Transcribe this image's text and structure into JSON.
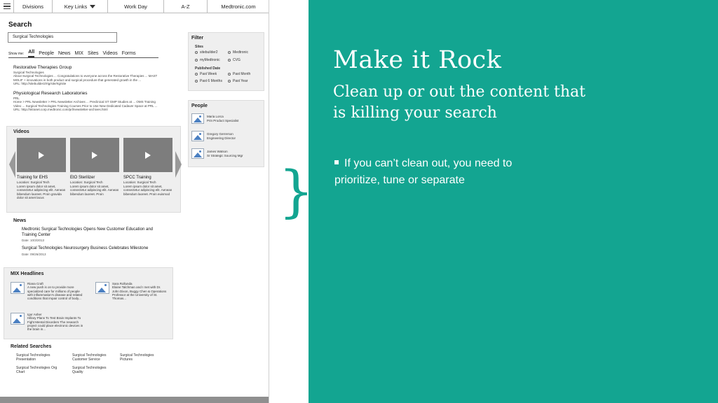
{
  "nav": {
    "divisions": "Divisions",
    "keylinks": "Key Links",
    "workday": "Work Day",
    "az": "A-Z",
    "site": "Medtronic.com"
  },
  "search": {
    "title": "Search",
    "value": "Surgical Technologies"
  },
  "tabs": {
    "label": "Show me:",
    "items": [
      "All",
      "People",
      "News",
      "MIX",
      "Sites",
      "Videos",
      "Forms"
    ]
  },
  "results": [
    {
      "title": "Restorative Therapies Group",
      "lines": [
        "Surgical Technologies",
        "About Surgical Technologies ... Congratulations to everyone across the Restorative Therapies ... MAST",
        "MOLIF + innovations in both product and surgical procedure that generated growth in the ...",
        "URL: http://sitebuilder2/rtg/site/rtg/site"
      ]
    },
    {
      "title": "Physiological Research Laboratories",
      "lines": [
        "PRL",
        "Home > PRL Newsletter > PRL Newsletter Archives ... Preclinical ST GMP Studies at ... OMS Training",
        "Video ... Surgical Technologies Training Courses Prior to Use New Dedicated Cadaver Space at PRL ...",
        "URL: http://intranet.corp.medtronic.com/prl/newsletter-archives.html"
      ]
    }
  ],
  "filter": {
    "title": "Filter",
    "sites_label": "Sites",
    "sites": [
      "sitebuilder2",
      "Medtronic",
      "myMedtronic",
      "CVG"
    ],
    "published_label": "Published Date",
    "dates": [
      "Past Week",
      "Past Month",
      "Past 6 Months",
      "Past Year"
    ]
  },
  "people": {
    "title": "People",
    "items": [
      {
        "name": "Maria Lorca",
        "role": "Prin Product Specialist"
      },
      {
        "name": "Gregory Gerrerson",
        "role": "Engineering Director"
      },
      {
        "name": "James Watson",
        "role": "Sr Strategic Sourcing Mgr"
      }
    ]
  },
  "videos": {
    "title": "Videos",
    "items": [
      {
        "title": "Training for EHS",
        "location": "Location: Surgical Tech",
        "desc": "Lorem ipsum dolor sit amet, consectetur adipiscing elit. Aenean bibendum laoreet. Proin gravida dolor sit amet lacus"
      },
      {
        "title": "EtO Sterilizer",
        "location": "Location: Surgical Tech",
        "desc": "Lorem ipsum dolor sit amet, consectetur adipiscing elit. Aenean bibendum laoreet. Proin"
      },
      {
        "title": "SPCC Training",
        "location": "Location: Surgical Tech",
        "desc": "Lorem ipsum dolor sit amet, consectetur adipiscing elit. Aenean bibendum laoreet. Proin euismod"
      }
    ]
  },
  "news": {
    "title": "News",
    "items": [
      {
        "title": "Medtronic Surgical Technologies Opens New Customer Education and Training Center",
        "date": "Date: 10/3/2013"
      },
      {
        "title": "Surgical Technologies Neurosurgery Business Celebrates Milestone",
        "date": "Date: 09/26/2013"
      }
    ]
  },
  "mix": {
    "title": "MIX Headlines",
    "items": [
      {
        "name": "Riana Craft",
        "text": "A new push is on to provide more specialized care for millions of people with inflammation's disease and related conditions that impair control of body..."
      },
      {
        "name": "Sara Rollunda",
        "text": "Elaine Talchman and I met with Dr. John Dixon, Buggy Chen & Operations Professor at the University of St. Thomas..."
      },
      {
        "name": "Igor Asher",
        "text": "Hillary Plans To Test Brain Implants To Fight Mental Disorders The research project could place electronic devices in the brain in..."
      }
    ]
  },
  "related": {
    "title": "Related Searches",
    "items": [
      "Surgical Technologies Presentation",
      "Surgical Technologies Customer Service",
      "Surgical Technologies Pictures",
      "Surgical Technologies Org Chart",
      "Surgical Technologies Quality"
    ]
  },
  "slide": {
    "headline": "Make it Rock",
    "subtitle": "Clean up or out the content that is killing your search",
    "bullet": "If you can’t clean out, you need to prioritize, tune or separate",
    "accent": "#13a591"
  }
}
